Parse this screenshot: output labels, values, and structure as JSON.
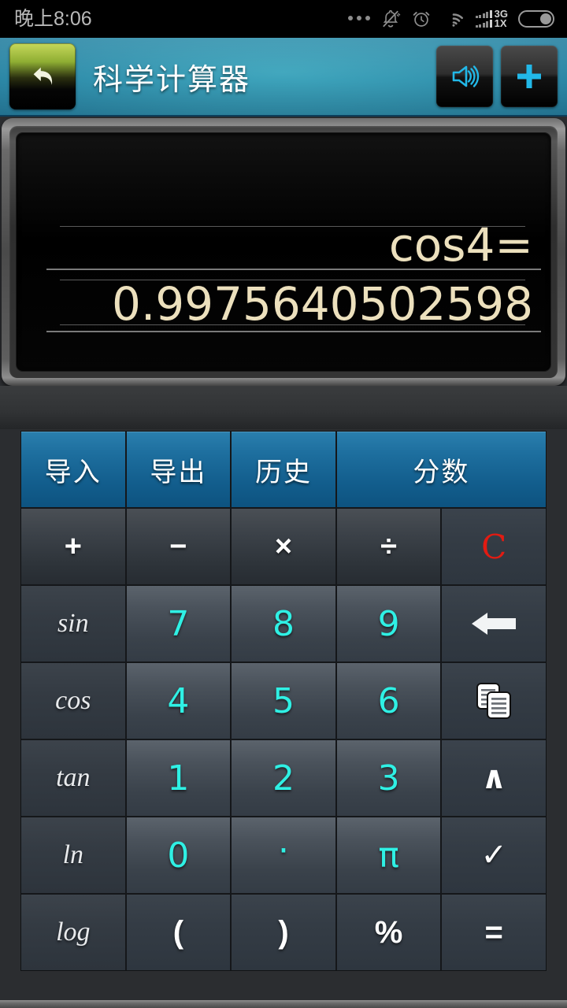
{
  "statusbar": {
    "time": "晚上8:06",
    "icons": [
      {
        "name": "more-dots-icon"
      },
      {
        "name": "bell-muted-icon"
      },
      {
        "name": "alarm-clock-icon"
      },
      {
        "name": "wifi-icon"
      },
      {
        "name": "signal-bars-icon"
      },
      {
        "name": "battery-icon"
      }
    ],
    "network_primary": "3G",
    "network_secondary": "1X"
  },
  "titlebar": {
    "title": "科学计算器",
    "back_icon": "back-arrow-icon",
    "sound_icon": "speaker-icon",
    "add_icon": "plus-icon"
  },
  "display": {
    "expression": "cos4=",
    "result": "0.9975640502598",
    "text_color": "#ece0bd",
    "background": "#000000"
  },
  "keypad": {
    "accent_blue": "#1d6e9e",
    "digit_cyan": "#2ff0e4",
    "clear_red": "#e31b12",
    "rows": [
      [
        {
          "label": "导入",
          "type": "blue",
          "name": "import-button",
          "span": 1
        },
        {
          "label": "导出",
          "type": "blue",
          "name": "export-button",
          "span": 1
        },
        {
          "label": "历史",
          "type": "blue",
          "name": "history-button",
          "span": 1
        },
        {
          "label": "分数",
          "type": "blue",
          "name": "fraction-button",
          "span": 2
        }
      ],
      [
        {
          "label": "+",
          "type": "op",
          "name": "plus-button",
          "span": 1
        },
        {
          "label": "−",
          "type": "op",
          "name": "minus-button",
          "span": 1
        },
        {
          "label": "×",
          "type": "op",
          "name": "multiply-button",
          "span": 1
        },
        {
          "label": "÷",
          "type": "op",
          "name": "divide-button",
          "span": 1
        },
        {
          "label": "C",
          "type": "clear",
          "name": "clear-button",
          "span": 1
        }
      ],
      [
        {
          "label": "sin",
          "type": "fn",
          "name": "sin-button",
          "span": 1
        },
        {
          "label": "7",
          "type": "num",
          "name": "digit-7-button",
          "span": 1
        },
        {
          "label": "8",
          "type": "num",
          "name": "digit-8-button",
          "span": 1
        },
        {
          "label": "9",
          "type": "num",
          "name": "digit-9-button",
          "span": 1
        },
        {
          "label": "",
          "type": "icon",
          "icon": "backspace-icon",
          "name": "backspace-button",
          "span": 1
        }
      ],
      [
        {
          "label": "cos",
          "type": "fn",
          "name": "cos-button",
          "span": 1
        },
        {
          "label": "4",
          "type": "num",
          "name": "digit-4-button",
          "span": 1
        },
        {
          "label": "5",
          "type": "num",
          "name": "digit-5-button",
          "span": 1
        },
        {
          "label": "6",
          "type": "num",
          "name": "digit-6-button",
          "span": 1
        },
        {
          "label": "",
          "type": "icon",
          "icon": "copy-icon",
          "name": "copy-button",
          "span": 1
        }
      ],
      [
        {
          "label": "tan",
          "type": "fn",
          "name": "tan-button",
          "span": 1
        },
        {
          "label": "1",
          "type": "num",
          "name": "digit-1-button",
          "span": 1
        },
        {
          "label": "2",
          "type": "num",
          "name": "digit-2-button",
          "span": 1
        },
        {
          "label": "3",
          "type": "num",
          "name": "digit-3-button",
          "span": 1
        },
        {
          "label": "∧",
          "type": "act",
          "name": "power-button",
          "span": 1
        }
      ],
      [
        {
          "label": "ln",
          "type": "fn",
          "name": "ln-button",
          "span": 1
        },
        {
          "label": "0",
          "type": "num",
          "name": "digit-0-button",
          "span": 1
        },
        {
          "label": "·",
          "type": "dot",
          "name": "decimal-point-button",
          "span": 1
        },
        {
          "label": "π",
          "type": "pi",
          "name": "pi-button",
          "span": 1
        },
        {
          "label": "✓",
          "type": "act",
          "name": "confirm-button",
          "span": 1
        }
      ],
      [
        {
          "label": "log",
          "type": "fn",
          "name": "log-button",
          "span": 1
        },
        {
          "label": "(",
          "type": "act",
          "name": "left-paren-button",
          "span": 1
        },
        {
          "label": ")",
          "type": "act",
          "name": "right-paren-button",
          "span": 1
        },
        {
          "label": "%",
          "type": "act",
          "name": "percent-button",
          "span": 1
        },
        {
          "label": "=",
          "type": "act",
          "name": "equals-button",
          "span": 1
        }
      ]
    ]
  }
}
